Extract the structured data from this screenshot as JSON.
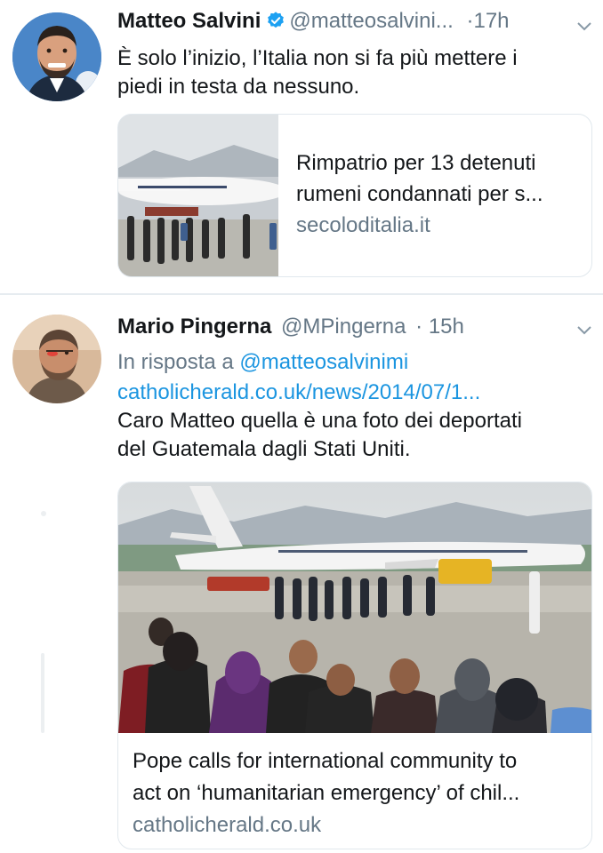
{
  "tweet1": {
    "display_name": "Matteo Salvini",
    "handle": "@matteosalvini...",
    "separator": "·",
    "time": "17h",
    "text_line1": "È solo l’inizio, l’Italia non si fa più mettere i",
    "text_line2": "piedi in testa da nessuno.",
    "card": {
      "title_line1": "Rimpatrio per 13 detenuti",
      "title_line2": "rumeni condannati per s...",
      "domain": "secoloditalia.it"
    }
  },
  "tweet2": {
    "display_name": "Mario Pingerna",
    "handle": "@MPingerna",
    "separator": "·",
    "time": "15h",
    "reply_prefix": "In risposta a",
    "reply_to": "@matteosalvinimi",
    "link": "catholicherald.co.uk/news/2014/07/1...",
    "text_line1": "Caro Matteo quella è una foto dei deportati",
    "text_line2": "del Guatemala dagli Stati Uniti.",
    "card": {
      "title_line1": "Pope calls for international community to",
      "title_line2": "act on ‘humanitarian emergency’ of chil...",
      "domain": "catholicherald.co.uk"
    }
  },
  "colors": {
    "text": "#14171a",
    "secondary": "#657786",
    "link": "#1b95e0",
    "verified": "#1da1f2",
    "border": "#e1e8ed"
  },
  "icons": [
    "verified-badge-icon",
    "chevron-down-icon"
  ]
}
